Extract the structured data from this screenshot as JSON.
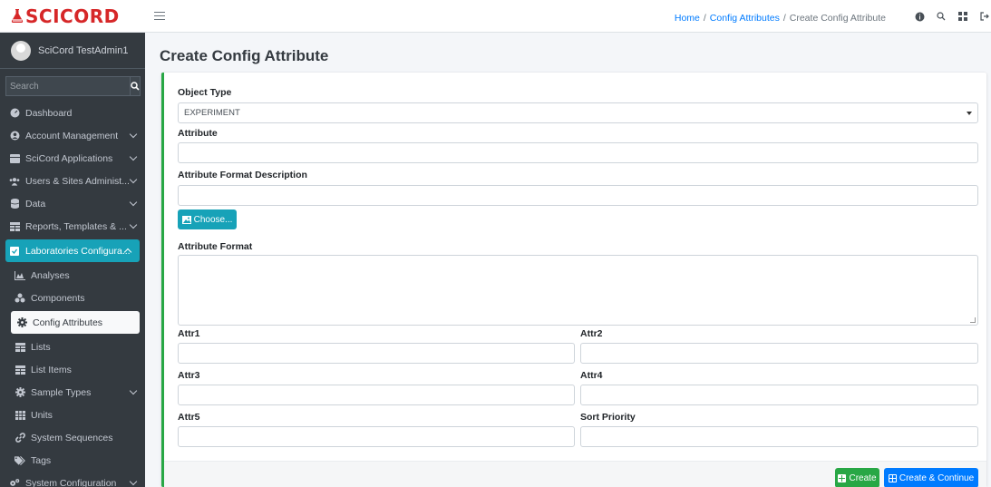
{
  "brand": {
    "name": "SCICORD",
    "color": "#d62728"
  },
  "user": {
    "name": "SciCord TestAdmin1"
  },
  "sidebar": {
    "search_placeholder": "Search",
    "items": [
      {
        "label": "Dashboard",
        "icon": "dashboard-icon"
      },
      {
        "label": "Account Management",
        "icon": "user-circle-icon"
      },
      {
        "label": "SciCord Applications",
        "icon": "apps-icon"
      },
      {
        "label": "Users & Sites Administ...",
        "icon": "users-icon"
      },
      {
        "label": "Data",
        "icon": "database-icon"
      },
      {
        "label": "Reports, Templates & ...",
        "icon": "table-icon"
      },
      {
        "label": "Laboratories Configura...",
        "icon": "clipboard-check-icon"
      }
    ],
    "sub_items": [
      {
        "label": "Analyses",
        "icon": "chart-area-icon"
      },
      {
        "label": "Components",
        "icon": "components-icon"
      },
      {
        "label": "Config Attributes",
        "icon": "cog-icon"
      },
      {
        "label": "Lists",
        "icon": "table-icon"
      },
      {
        "label": "List Items",
        "icon": "table-icon"
      },
      {
        "label": "Sample Types",
        "icon": "cog-icon"
      },
      {
        "label": "Units",
        "icon": "grid-icon"
      },
      {
        "label": "System Sequences",
        "icon": "link-icon"
      },
      {
        "label": "Tags",
        "icon": "tags-icon"
      }
    ],
    "last_item": {
      "label": "System Configuration",
      "icon": "cogs-icon"
    }
  },
  "breadcrumb": {
    "home": "Home",
    "config": "Config Attributes",
    "current": "Create Config Attribute",
    "separator": "/"
  },
  "page_title": "Create Config Attribute",
  "form": {
    "object_type_label": "Object Type",
    "object_type_value": "EXPERIMENT",
    "attribute_label": "Attribute",
    "attribute_format_description_label": "Attribute Format Description",
    "choose_label": "Choose...",
    "attribute_format_label": "Attribute Format",
    "attr1_label": "Attr1",
    "attr2_label": "Attr2",
    "attr3_label": "Attr3",
    "attr4_label": "Attr4",
    "attr5_label": "Attr5",
    "sort_priority_label": "Sort Priority"
  },
  "buttons": {
    "create": "Create",
    "create_continue": "Create & Continue"
  },
  "colors": {
    "accent_teal": "#17a2b8",
    "success": "#28a745",
    "primary": "#007bff",
    "sidebar_bg": "#343a40"
  }
}
